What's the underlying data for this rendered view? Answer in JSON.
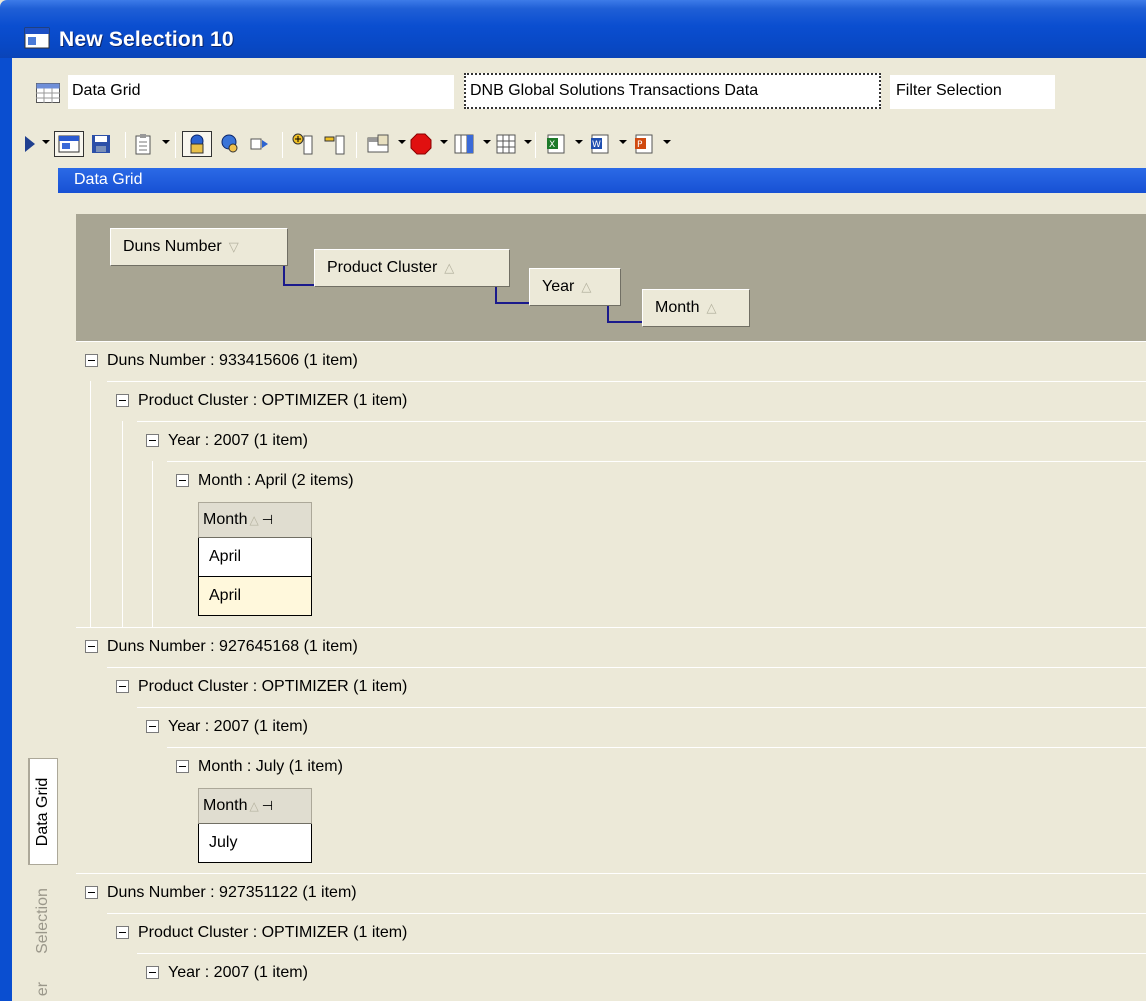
{
  "window": {
    "title": "New Selection 10"
  },
  "info": {
    "grid_name": "Data Grid",
    "table_name": "DNB Global Solutions Transactions Data",
    "filter": "Filter Selection"
  },
  "toolbar": {
    "icons": [
      "run-icon",
      "new-window-icon",
      "save-icon",
      "clipboard-icon",
      "user-lock-icon",
      "user-search-icon",
      "export-arrow-icon",
      "add-column-icon",
      "remove-column-icon",
      "properties-icon",
      "stop-icon",
      "columns-icon",
      "grid-icon",
      "excel-icon",
      "word-icon",
      "powerpoint-icon"
    ]
  },
  "section": {
    "title": "Data Grid"
  },
  "tabs": {
    "data_grid": "Data Grid",
    "selection": "Selection",
    "filter_partial": "er"
  },
  "groupby": {
    "chips": [
      "Duns Number",
      "Product Cluster",
      "Year",
      "Month"
    ]
  },
  "tree": {
    "g1": {
      "duns": "Duns Number : 933415606 (1 item)",
      "cluster": "Product Cluster : OPTIMIZER (1 item)",
      "year": "Year : 2007 (1 item)",
      "month": "Month : April (2 items)",
      "col_header": "Month",
      "rows": [
        "April",
        "April"
      ]
    },
    "g2": {
      "duns": "Duns Number : 927645168 (1 item)",
      "cluster": "Product Cluster : OPTIMIZER (1 item)",
      "year": "Year : 2007 (1 item)",
      "month": "Month : July (1 item)",
      "col_header": "Month",
      "rows": [
        "July"
      ]
    },
    "g3": {
      "duns": "Duns Number : 927351122 (1 item)",
      "cluster": "Product Cluster : OPTIMIZER (1 item)",
      "year": "Year : 2007 (1 item)"
    }
  },
  "colors": {
    "title_blue": "#0a4ed0",
    "panel": "#ece9d8",
    "groupby_bg": "#a8a593",
    "alt_row": "#fff8dc"
  }
}
